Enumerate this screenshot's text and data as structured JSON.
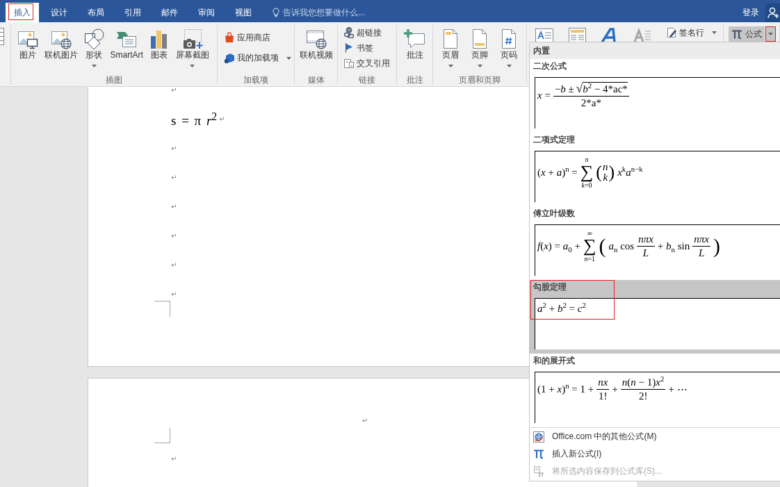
{
  "title_bar": {
    "tabs": [
      {
        "label": "插入",
        "selected": true,
        "annotated": true
      },
      {
        "label": "设计",
        "selected": false,
        "annotated": false
      },
      {
        "label": "布局",
        "selected": false,
        "annotated": false
      },
      {
        "label": "引用",
        "selected": false,
        "annotated": false
      },
      {
        "label": "邮件",
        "selected": false,
        "annotated": false
      },
      {
        "label": "审阅",
        "selected": false,
        "annotated": false
      },
      {
        "label": "视图",
        "selected": false,
        "annotated": false
      }
    ],
    "tell_me": {
      "placeholder": "告诉我您想要做什么..."
    },
    "sign_in": "登录"
  },
  "ribbon": {
    "groups": [
      {
        "label": "插图",
        "kind": "large",
        "buttons": [
          {
            "label": "图片",
            "dropdown": false
          },
          {
            "label": "联机图片",
            "dropdown": false
          },
          {
            "label": "形状",
            "dropdown": true
          },
          {
            "label": "SmartArt",
            "dropdown": false
          },
          {
            "label": "图表",
            "dropdown": false
          },
          {
            "label": "屏幕截图",
            "dropdown": true
          }
        ]
      },
      {
        "label": "加载项",
        "kind": "small",
        "buttons": [
          {
            "label": "应用商店",
            "dropdown": false
          },
          {
            "label": "我的加载项",
            "dropdown": true
          }
        ]
      },
      {
        "label": "媒体",
        "kind": "large",
        "buttons": [
          {
            "label": "联机视频",
            "dropdown": false
          }
        ]
      },
      {
        "label": "链接",
        "kind": "small",
        "buttons": [
          {
            "label": "超链接",
            "dropdown": false
          },
          {
            "label": "书签",
            "dropdown": false
          },
          {
            "label": "交叉引用",
            "dropdown": false
          }
        ]
      },
      {
        "label": "批注",
        "kind": "large",
        "buttons": [
          {
            "label": "批注",
            "dropdown": false
          }
        ]
      },
      {
        "label": "页眉和页脚",
        "kind": "large",
        "buttons": [
          {
            "label": "页眉",
            "dropdown": true
          },
          {
            "label": "页脚",
            "dropdown": true
          },
          {
            "label": "页码",
            "dropdown": true
          }
        ]
      },
      {
        "kind": "mixed",
        "buttons": [
          {
            "kind": "icon"
          },
          {
            "kind": "icon"
          },
          {
            "kind": "icon"
          },
          {
            "kind": "icon"
          },
          {
            "kind": "small",
            "label": "签名行",
            "dropdown": true
          }
        ]
      },
      {
        "kind": "split",
        "buttons": [
          {
            "label": "公式",
            "pressed": true,
            "annotated": true
          }
        ]
      }
    ]
  },
  "document": {
    "pages": [
      {
        "paragraphs": [
          {
            "mark": "↵"
          },
          {
            "formula": "s = π *r*$^{2}$",
            "mark": "↵"
          },
          {
            "mark": "↵"
          },
          {
            "mark": "↵"
          },
          {
            "mark": "↵"
          },
          {
            "mark": "↵"
          },
          {
            "mark": "↵"
          },
          {
            "mark": "↵"
          }
        ]
      },
      {
        "header": {
          "mark": "↵"
        },
        "paragraphs": [
          {
            "mark": "↵"
          }
        ]
      }
    ]
  },
  "equation_gallery": {
    "header": "内置",
    "items": [
      {
        "title": "二次公式",
        "hovered": false,
        "annotated": false,
        "formula": [
          {
            "kind": "text",
            "text": "*x* ="
          },
          {
            "kind": "frac",
            "num": [
              {
                "kind": "text",
                "text": "−*b* ±"
              },
              {
                "kind": "sqrt",
                "sign": "√",
                "body": "*b*$^{2}$ − 4*ac*"
              }
            ],
            "den": [
              {
                "kind": "text",
                "text": "2*a*"
              }
            ]
          }
        ]
      },
      {
        "title": "二项式定理",
        "hovered": false,
        "annotated": false,
        "formula": [
          {
            "kind": "text",
            "text": "(*x* + *a*)$^{n}$ ="
          },
          {
            "kind": "sum",
            "symbol": "∑",
            "over": "*n*",
            "under": "*k*=0"
          },
          {
            "kind": "binom",
            "open": "(",
            "top": "*n*",
            "bottom": "*k*",
            "close": ")"
          },
          {
            "kind": "text",
            "text": "*x*$^{k}$*a*$^{n−k}$"
          }
        ]
      },
      {
        "title": "傅立叶级数",
        "hovered": false,
        "annotated": false,
        "formula": [
          {
            "kind": "text",
            "text": "*f*(*x*) = *a*$_{0}$ +"
          },
          {
            "kind": "sum",
            "symbol": "∑",
            "over": "∞",
            "under": "*n*=1"
          },
          {
            "kind": "group",
            "open": "(",
            "close": ")",
            "body": [
              {
                "kind": "text",
                "text": "*a*$_{n}$ cos"
              },
              {
                "kind": "frac",
                "num": [
                  {
                    "kind": "text",
                    "text": "*nπx*"
                  }
                ],
                "den": [
                  {
                    "kind": "text",
                    "text": "*L*"
                  }
                ]
              },
              {
                "kind": "text",
                "text": "+ *b*$_{n}$ sin"
              },
              {
                "kind": "frac",
                "num": [
                  {
                    "kind": "text",
                    "text": "*nπx*"
                  }
                ],
                "den": [
                  {
                    "kind": "text",
                    "text": "*L*"
                  }
                ]
              }
            ]
          }
        ]
      },
      {
        "title": "勾股定理",
        "hovered": true,
        "annotated": true,
        "formula": [
          {
            "kind": "text",
            "text": "*a*$^{2}$ + *b*$^{2}$ = *c*$^{2}$"
          }
        ]
      },
      {
        "title": "和的展开式",
        "hovered": false,
        "annotated": false,
        "formula": [
          {
            "kind": "text",
            "text": "(1 + *x*)$^{n}$ = 1 +"
          },
          {
            "kind": "frac",
            "num": [
              {
                "kind": "text",
                "text": "*nx*"
              }
            ],
            "den": [
              {
                "kind": "text",
                "text": "1!"
              }
            ]
          },
          {
            "kind": "text",
            "text": "+"
          },
          {
            "kind": "frac",
            "num": [
              {
                "kind": "text",
                "text": "*n*(*n* − 1)*x*$^{2}$"
              }
            ],
            "den": [
              {
                "kind": "text",
                "text": "2!"
              }
            ]
          },
          {
            "kind": "text",
            "text": "+ ⋯"
          }
        ]
      }
    ],
    "menu": [
      {
        "label": "Office.com 中的其他公式(M)",
        "disabled": false
      },
      {
        "label": "插入新公式(I)",
        "disabled": false
      },
      {
        "label": "将所选内容保存到公式库(S)...",
        "disabled": true
      }
    ]
  }
}
